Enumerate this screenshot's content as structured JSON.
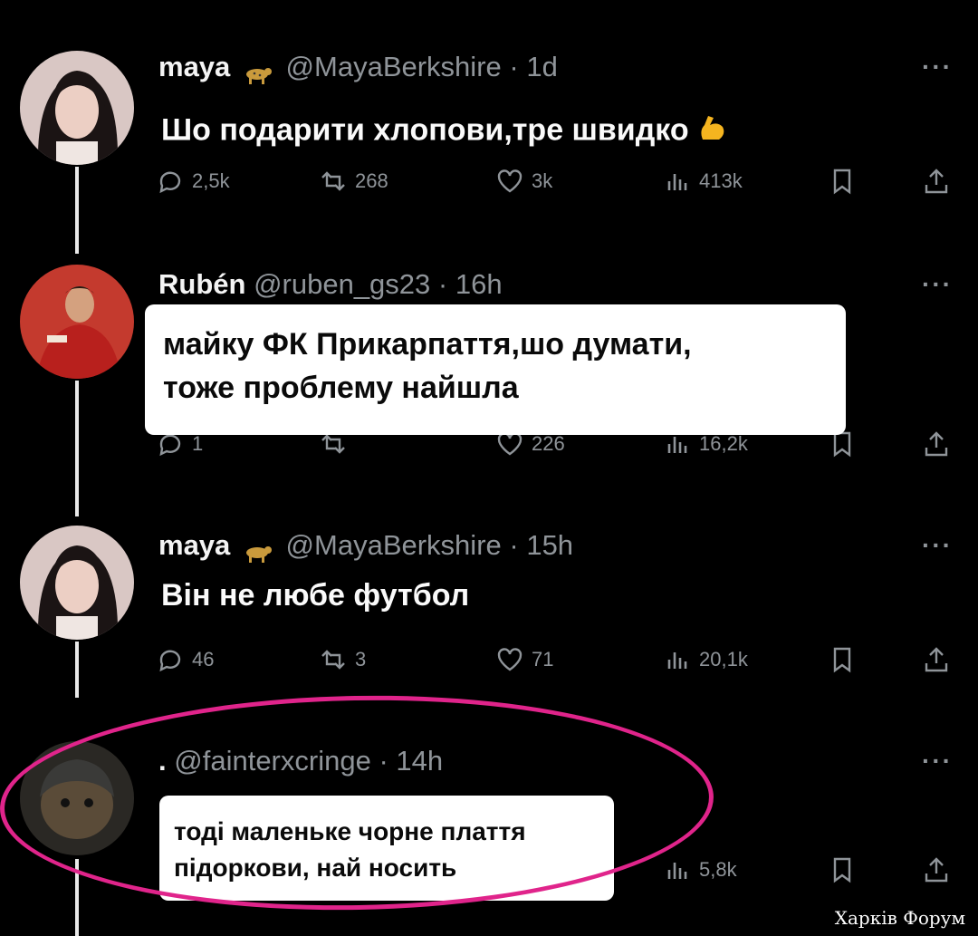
{
  "tweets": [
    {
      "name": "maya",
      "handle": "@MayaBerkshire",
      "time": "· 1d",
      "text": "Шо подарити хлопови,тре швидко",
      "emoji": "flexed-biceps",
      "stats": {
        "replies": "2,5k",
        "reposts": "268",
        "likes": "3k",
        "views": "413k"
      }
    },
    {
      "name": "Rubén",
      "handle": "@ruben_gs23",
      "time": "· 16h",
      "text_lines": [
        "майку ФК Прикарпаття,шо думати,",
        "тоже проблему найшла"
      ],
      "stats": {
        "replies": "1",
        "reposts": "",
        "likes": "226",
        "views": "16,2k"
      }
    },
    {
      "name": "maya",
      "handle": "@MayaBerkshire",
      "time": "· 15h",
      "text": "Він не любе футбол",
      "stats": {
        "replies": "46",
        "reposts": "3",
        "likes": "71",
        "views": "20,1k"
      }
    },
    {
      "name": ".",
      "handle": "@fainterxcringe",
      "time": "· 14h",
      "text_lines": [
        "тоді маленьке чорне плаття",
        "підоркови, най носить"
      ],
      "stats": {
        "views": "5,8k"
      }
    }
  ],
  "more_label": "···",
  "watermark": "Харків Форум",
  "colors": {
    "highlight": "#e0248b",
    "background": "#000000",
    "muted": "#8f9499"
  }
}
